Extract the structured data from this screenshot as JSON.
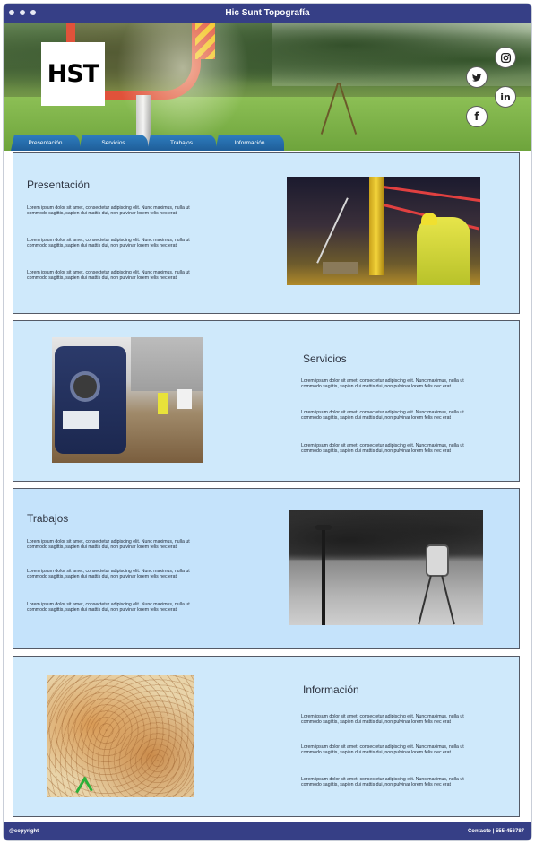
{
  "window": {
    "title": "Hic Sunt Topografía"
  },
  "header": {
    "logo_text": "HST",
    "social": [
      "instagram-icon",
      "twitter-icon",
      "linkedin-icon",
      "facebook-icon"
    ]
  },
  "nav": {
    "tabs": [
      "Presentación",
      "Servicios",
      "Trabajos",
      "Información"
    ]
  },
  "sections": {
    "presentacion": {
      "title": "Presentación",
      "paragraphs": [
        "Lorem ipsum dolor sit amet, consectetur adipiscing elit. Nunc maximus, nulla ut commodo sagittis, sapien dui mattis dui, non pulvinar lorem felis nec erat",
        "Lorem ipsum dolor sit amet, consectetur adipiscing elit. Nunc maximus, nulla ut commodo sagittis, sapien dui mattis dui, non pulvinar lorem felis nec erat",
        "Lorem ipsum dolor sit amet, consectetur adipiscing elit. Nunc maximus, nulla ut commodo sagittis, sapien dui mattis dui, non pulvinar lorem felis nec erat"
      ]
    },
    "servicios": {
      "title": "Servicios",
      "paragraphs": [
        "Lorem ipsum dolor sit amet, consectetur adipiscing elit. Nunc maximus, nulla ut commodo sagittis, sapien dui mattis dui, non pulvinar lorem felis nec erat",
        "Lorem ipsum dolor sit amet, consectetur adipiscing elit. Nunc maximus, nulla ut commodo sagittis, sapien dui mattis dui, non pulvinar lorem felis nec erat",
        "Lorem ipsum dolor sit amet, consectetur adipiscing elit. Nunc maximus, nulla ut commodo sagittis, sapien dui mattis dui, non pulvinar lorem felis nec erat"
      ]
    },
    "trabajos": {
      "title": "Trabajos",
      "paragraphs": [
        "Lorem ipsum dolor sit amet, consectetur adipiscing elit. Nunc maximus, nulla ut commodo sagittis, sapien dui mattis dui, non pulvinar lorem felis nec erat",
        "Lorem ipsum dolor sit amet, consectetur adipiscing elit. Nunc maximus, nulla ut commodo sagittis, sapien dui mattis dui, non pulvinar lorem felis nec erat",
        "Lorem ipsum dolor sit amet, consectetur adipiscing elit. Nunc maximus, nulla ut commodo sagittis, sapien dui mattis dui, non pulvinar lorem felis nec erat"
      ]
    },
    "informacion": {
      "title": "Información",
      "paragraphs": [
        "Lorem ipsum dolor sit amet, consectetur adipiscing elit. Nunc maximus, nulla ut commodo sagittis, sapien dui mattis dui, non pulvinar lorem felis nec erat",
        "Lorem ipsum dolor sit amet, consectetur adipiscing elit. Nunc maximus, nulla ut commodo sagittis, sapien dui mattis dui, non pulvinar lorem felis nec erat",
        "Lorem ipsum dolor sit amet, consectetur adipiscing elit. Nunc maximus, nulla ut commodo sagittis, sapien dui mattis dui, non pulvinar lorem felis nec erat"
      ]
    }
  },
  "footer": {
    "copyright": "@copyright",
    "contact": "Contacto | 555-456787"
  },
  "colors": {
    "titlebar": "#363f86",
    "tab": "#1f5e99",
    "section_bg": "#cfe9fb"
  }
}
